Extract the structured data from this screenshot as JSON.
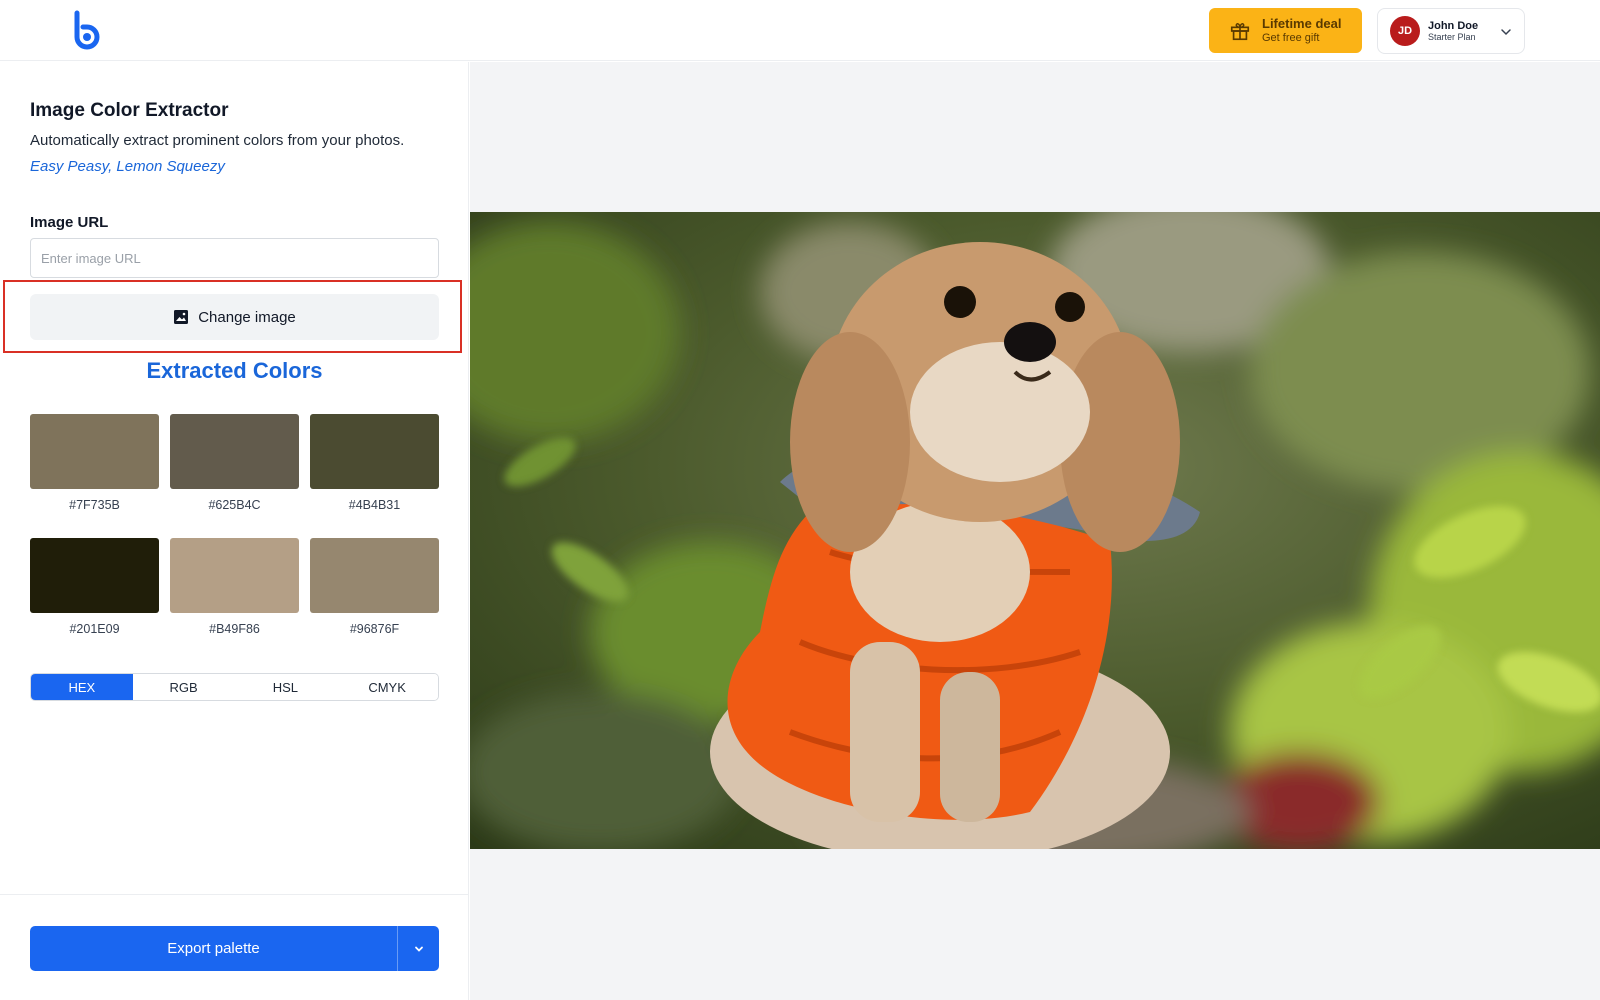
{
  "header": {
    "deal": {
      "title": "Lifetime deal",
      "subtitle": "Get free gift"
    },
    "user": {
      "initials": "JD",
      "name": "John Doe",
      "plan": "Starter Plan"
    }
  },
  "sidebar": {
    "title": "Image Color Extractor",
    "description": "Automatically extract prominent colors from your photos.",
    "tagline": "Easy Peasy, Lemon Squeezy",
    "url_label": "Image URL",
    "url_placeholder": "Enter image URL",
    "url_value": "",
    "change_image_label": "Change image",
    "extracted_title": "Extracted Colors",
    "colors": [
      {
        "hex": "#7F735B",
        "label": "#7F735B"
      },
      {
        "hex": "#625B4C",
        "label": "#625B4C"
      },
      {
        "hex": "#4B4B31",
        "label": "#4B4B31"
      },
      {
        "hex": "#201E09",
        "label": "#201E09"
      },
      {
        "hex": "#B49F86",
        "label": "#B49F86"
      },
      {
        "hex": "#96876F",
        "label": "#96876F"
      }
    ],
    "formats": [
      "HEX",
      "RGB",
      "HSL",
      "CMYK"
    ],
    "active_format": "HEX",
    "export_label": "Export palette"
  },
  "theme": {
    "accent": "#1a66f0",
    "deal_color": "#fbb316",
    "avatar_color": "#b91c1c",
    "highlight": "#d93025"
  }
}
